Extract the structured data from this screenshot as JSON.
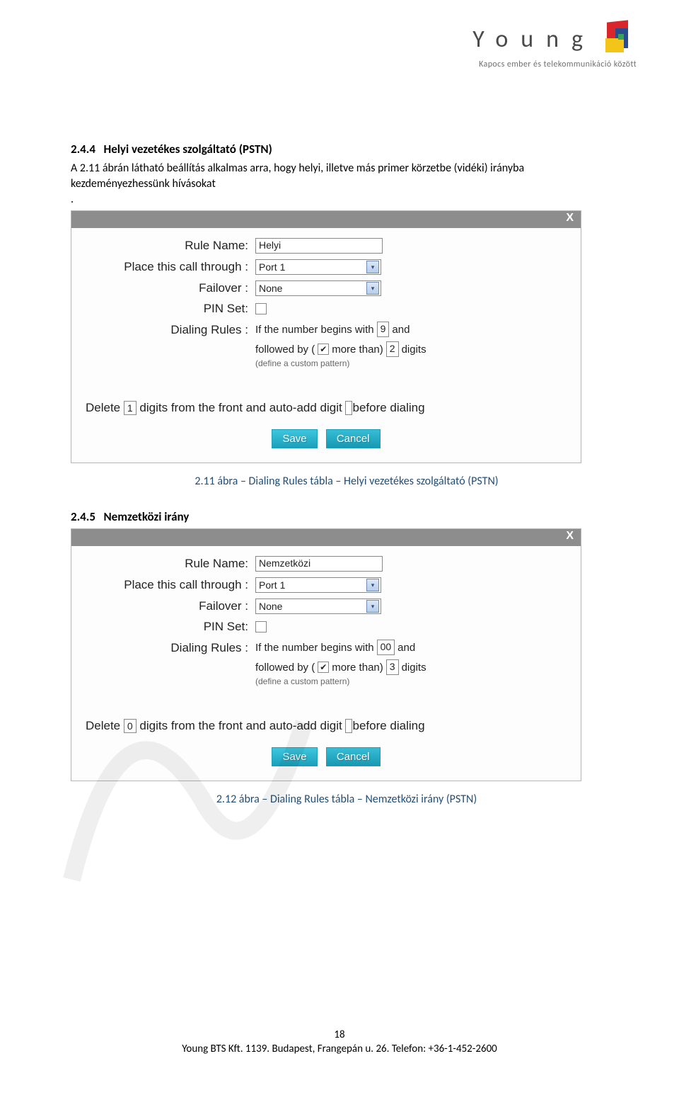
{
  "header": {
    "logo_text": "Young",
    "tagline": "Kapocs ember és telekommunikáció között"
  },
  "section1": {
    "number": "2.4.4",
    "title": "Helyi vezetékes szolgáltató (PSTN)",
    "body": "A 2.11 ábrán látható beállítás alkalmas arra, hogy helyi, illetve más primer körzetbe (vidéki) irányba kezdeményezhessünk hívásokat",
    "dot": "."
  },
  "dialog_labels": {
    "rule_name": "Rule Name:",
    "place_through": "Place this call through :",
    "failover": "Failover :",
    "pin_set": "PIN Set:",
    "dialing_rules": "Dialing Rules :",
    "rule_text_begin": "If the number begins with",
    "rule_text_and": "and",
    "rule_text_followed": "followed by (",
    "rule_text_more": "more than)",
    "rule_text_digits": "digits",
    "custom_pattern": "(define a custom pattern)",
    "delete_1": "Delete",
    "delete_2": "digits from the front and auto-add digit",
    "delete_3": "before dialing",
    "save": "Save",
    "cancel": "Cancel",
    "close": "X"
  },
  "dialog1": {
    "rule_name_val": "Helyi",
    "place_through_val": "Port 1",
    "failover_val": "None",
    "pin_checked": "",
    "begins_with": "9",
    "more_than_checked": "✔",
    "digits_count": "2",
    "delete_digits": "1",
    "auto_add": ""
  },
  "caption1": "2.11 ábra – Dialing Rules tábla – Helyi vezetékes szolgáltató (PSTN)",
  "section2": {
    "number": "2.4.5",
    "title": "Nemzetközi irány"
  },
  "dialog2": {
    "rule_name_val": "Nemzetközi",
    "place_through_val": "Port 1",
    "failover_val": "None",
    "pin_checked": "",
    "begins_with": "00",
    "more_than_checked": "✔",
    "digits_count": "3",
    "delete_digits": "0",
    "auto_add": ""
  },
  "caption2": "2.12 ábra – Dialing Rules tábla – Nemzetközi irány (PSTN)",
  "footer": {
    "page_number": "18",
    "line": "Young BTS Kft. 1139. Budapest, Frangepán u. 26. Telefon: +36-1-452-2600"
  }
}
